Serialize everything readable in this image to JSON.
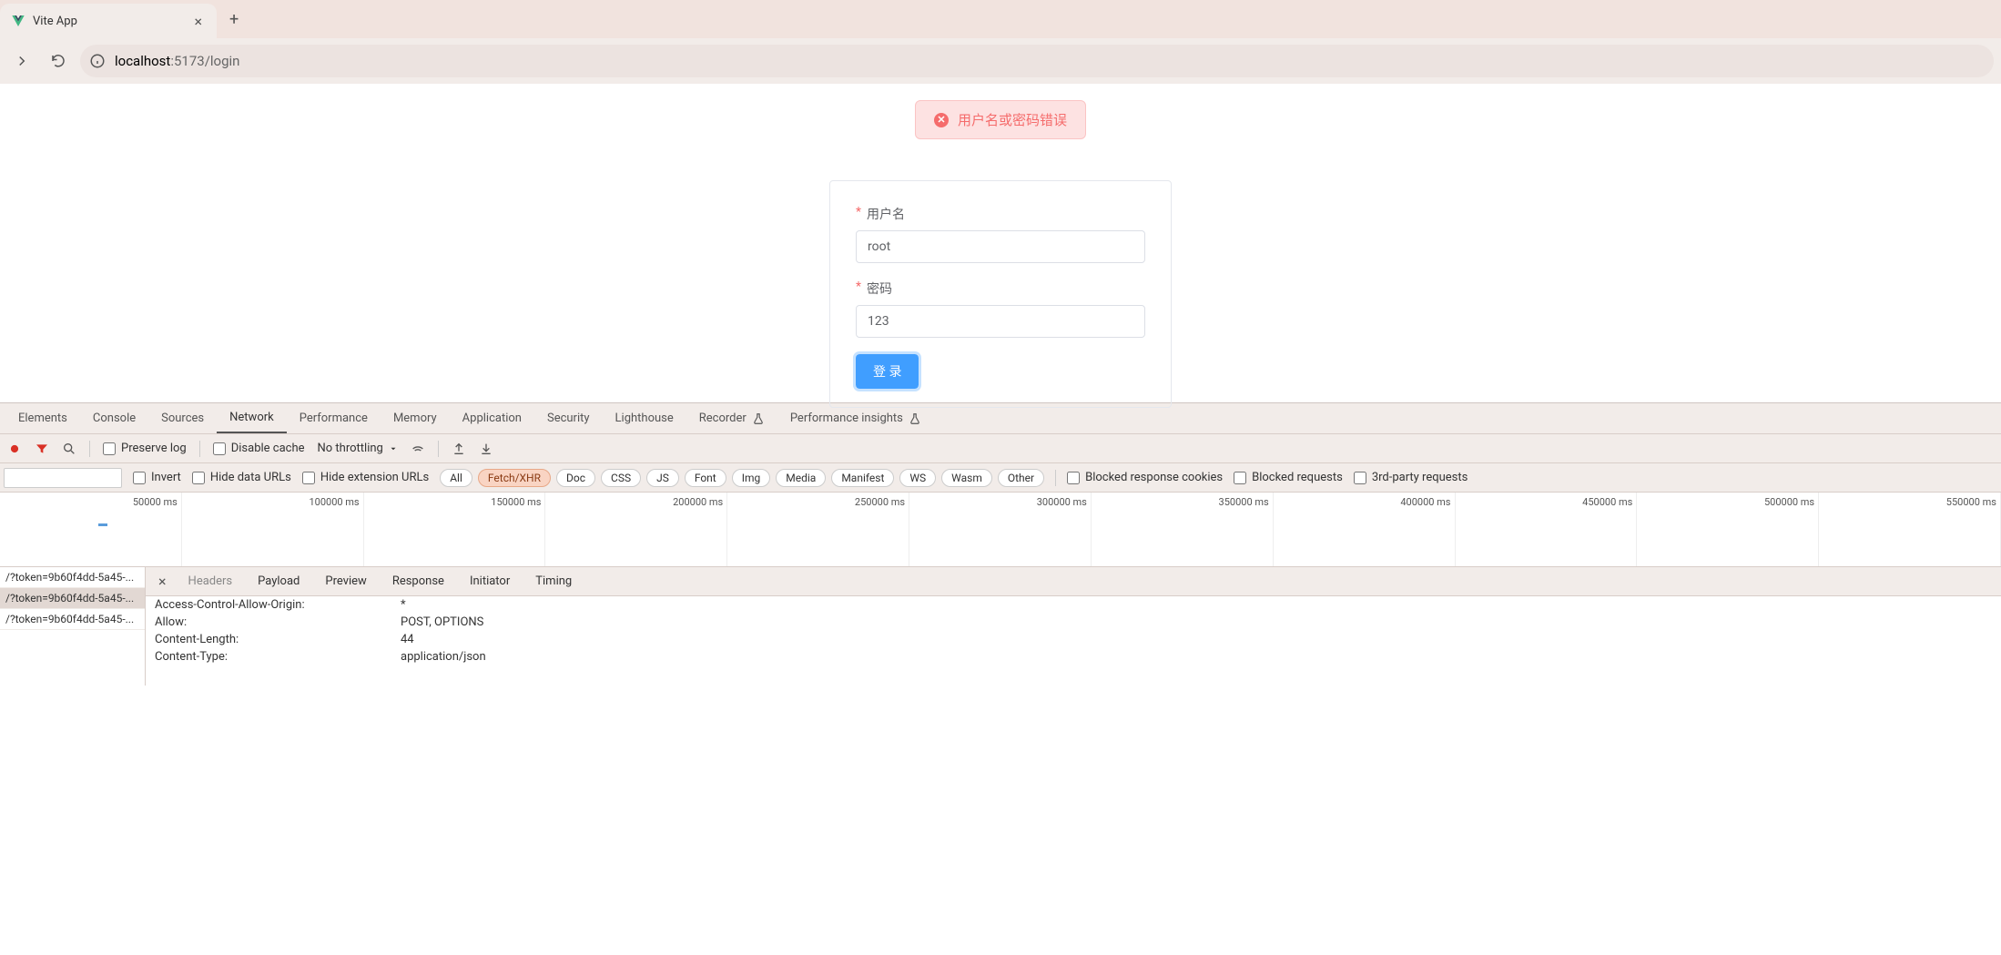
{
  "browser": {
    "tab_title": "Vite App",
    "url_host": "localhost",
    "url_port": ":5173",
    "url_path": "/login"
  },
  "page": {
    "error_msg": "用户名或密码错误",
    "username_label": "用户名",
    "password_label": "密码",
    "username_value": "root",
    "password_value": "123",
    "login_btn": "登 录"
  },
  "devtools": {
    "tabs": [
      "Elements",
      "Console",
      "Sources",
      "Network",
      "Performance",
      "Memory",
      "Application",
      "Security",
      "Lighthouse",
      "Recorder",
      "Performance insights"
    ],
    "active_tab": "Network",
    "toolbar": {
      "preserve_log": "Preserve log",
      "disable_cache": "Disable cache",
      "throttling": "No throttling"
    },
    "filters": {
      "invert": "Invert",
      "hide_data": "Hide data URLs",
      "hide_ext": "Hide extension URLs",
      "types": [
        "All",
        "Fetch/XHR",
        "Doc",
        "CSS",
        "JS",
        "Font",
        "Img",
        "Media",
        "Manifest",
        "WS",
        "Wasm",
        "Other"
      ],
      "active_type": "Fetch/XHR",
      "blocked_cookies": "Blocked response cookies",
      "blocked_requests": "Blocked requests",
      "third_party": "3rd-party requests"
    },
    "timeline_ticks": [
      "50000 ms",
      "100000 ms",
      "150000 ms",
      "200000 ms",
      "250000 ms",
      "300000 ms",
      "350000 ms",
      "400000 ms",
      "450000 ms",
      "500000 ms",
      "550000 ms"
    ],
    "requests": [
      "/?token=9b60f4dd-5a45-...",
      "/?token=9b60f4dd-5a45-...",
      "/?token=9b60f4dd-5a45-..."
    ],
    "detail_tabs": [
      "Headers",
      "Payload",
      "Preview",
      "Response",
      "Initiator",
      "Timing"
    ],
    "active_detail_tab": "Headers",
    "headers": [
      {
        "k": "Access-Control-Allow-Origin:",
        "v": "*"
      },
      {
        "k": "Allow:",
        "v": "POST, OPTIONS"
      },
      {
        "k": "Content-Length:",
        "v": "44"
      },
      {
        "k": "Content-Type:",
        "v": "application/json"
      }
    ]
  }
}
